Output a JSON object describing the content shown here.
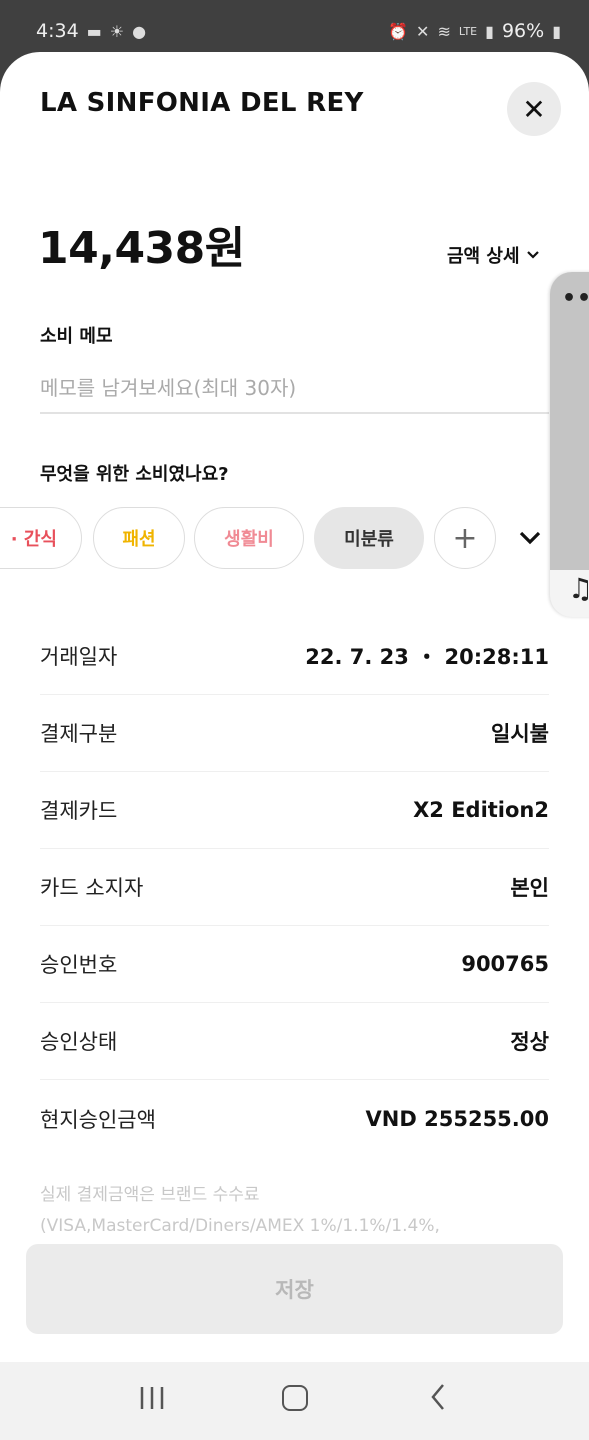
{
  "status_bar": {
    "time": "4:34",
    "battery": "96%",
    "network": "LTE"
  },
  "header": {
    "merchant_name": "LA SINFONIA DEL REY",
    "close_icon": "✕"
  },
  "amount": {
    "value": "14,438원",
    "detail_label": "금액 상세"
  },
  "memo": {
    "label": "소비 메모",
    "placeholder": "메모를 남겨보세요(최대 30자)",
    "value": ""
  },
  "category": {
    "question": "무엇을 위한 소비였나요?",
    "chips": [
      {
        "label": "· 간식",
        "color": "#e8505b"
      },
      {
        "label": "패션",
        "color": "#f0b400"
      },
      {
        "label": "생활비",
        "color": "#f08a94"
      },
      {
        "label": "미분류",
        "color": "#333333"
      }
    ],
    "add_label": "+"
  },
  "details": [
    {
      "label": "거래일자",
      "value": "22. 7. 23 ・ 20:28:11"
    },
    {
      "label": "결제구분",
      "value": "일시불"
    },
    {
      "label": "결제카드",
      "value": "X2 Edition2"
    },
    {
      "label": "카드 소지자",
      "value": "본인"
    },
    {
      "label": "승인번호",
      "value": "900765"
    },
    {
      "label": "승인상태",
      "value": "정상"
    },
    {
      "label": "현지승인금액",
      "value": "VND 255255.00"
    }
  ],
  "notice": {
    "line1": "실제 결제금액은 브랜드 수수료",
    "line2": "(VISA,MasterCard/Diners/AMEX 1%/1.1%/1.4%,"
  },
  "save_button": {
    "label": "저장"
  },
  "icons": {
    "close": "close-icon",
    "chevron": "chevron-down-icon",
    "more": "more-dots-icon",
    "music": "music-note-icon"
  }
}
